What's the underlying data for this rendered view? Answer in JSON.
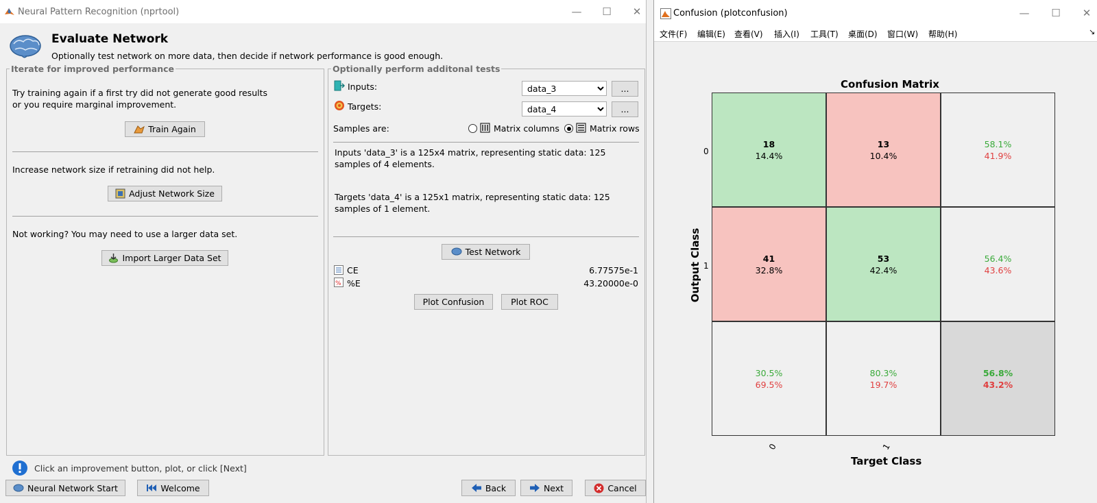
{
  "left_window": {
    "title": "Neural Pattern Recognition (nprtool)",
    "controls": {
      "minimize": "—",
      "maximize": "☐",
      "close": "✕"
    },
    "header": {
      "title": "Evaluate Network",
      "subtitle": "Optionally test network on more data, then decide if network performance is good enough."
    },
    "iterate_panel": {
      "legend": "Iterate for improved performance",
      "retrain_text_1": "Try training again if a first try did not generate good results",
      "retrain_text_2": "or you require marginal improvement.",
      "train_again_label": "Train Again",
      "size_text": "Increase network size if retraining did not help.",
      "adjust_size_label": "Adjust Network Size",
      "data_text": "Not working? You may need to use a larger data set.",
      "import_label": "Import Larger Data Set"
    },
    "tests_panel": {
      "legend": "Optionally perform additonal tests",
      "inputs_label": "Inputs:",
      "inputs_value": "data_3",
      "targets_label": "Targets:",
      "targets_value": "data_4",
      "browse_label": "...",
      "samples_label": "Samples are:",
      "matrix_columns_label": "Matrix columns",
      "matrix_rows_label": "Matrix rows",
      "samples_selected": "rows",
      "inputs_desc": "Inputs 'data_3' is a 125x4 matrix, representing static data: 125 samples of 4 elements.",
      "targets_desc": "Targets 'data_4' is a 125x1 matrix, representing static data: 125 samples of 1 element.",
      "test_network_label": "Test Network",
      "ce_label": "CE",
      "ce_value": "6.77575e-1",
      "pe_label": "%E",
      "pe_value": "43.20000e-0",
      "plot_confusion_label": "Plot Confusion",
      "plot_roc_label": "Plot ROC"
    },
    "status_text": "Click an improvement button, plot, or click [Next]",
    "footer": {
      "nn_start_label": "Neural Network Start",
      "welcome_label": "Welcome",
      "back_label": "Back",
      "next_label": "Next",
      "cancel_label": "Cancel"
    }
  },
  "right_window": {
    "title": "Confusion (plotconfusion)",
    "controls": {
      "minimize": "—",
      "maximize": "☐",
      "close": "✕"
    },
    "menu": [
      "文件(F)",
      "编辑(E)",
      "查看(V)",
      "插入(I)",
      "工具(T)",
      "桌面(D)",
      "窗口(W)",
      "帮助(H)"
    ],
    "dock_arrow": "↘",
    "plot": {
      "title": "Confusion Matrix",
      "ylabel": "Output Class",
      "xlabel": "Target Class",
      "row_ticks": [
        "0",
        "1"
      ],
      "col_ticks": [
        "0",
        "1"
      ],
      "cells": [
        [
          {
            "count": "18",
            "pct": "14.4%",
            "kind": "correct"
          },
          {
            "count": "13",
            "pct": "10.4%",
            "kind": "wrong"
          },
          {
            "top": "58.1%",
            "bottom": "41.9%",
            "kind": "summary"
          }
        ],
        [
          {
            "count": "41",
            "pct": "32.8%",
            "kind": "wrong"
          },
          {
            "count": "53",
            "pct": "42.4%",
            "kind": "correct"
          },
          {
            "top": "56.4%",
            "bottom": "43.6%",
            "kind": "summary"
          }
        ],
        [
          {
            "top": "30.5%",
            "bottom": "69.5%",
            "kind": "summary"
          },
          {
            "top": "80.3%",
            "bottom": "19.7%",
            "kind": "summary"
          },
          {
            "top": "56.8%",
            "bottom": "43.2%",
            "kind": "total"
          }
        ]
      ]
    },
    "colors": {
      "correct_fill": "#bce6c1",
      "wrong_fill": "#f7c3bf",
      "summary_fill": "#f0f0f0",
      "total_fill": "#d9d9d9",
      "green_text": "#3aaa3a",
      "red_text": "#e04040"
    }
  }
}
